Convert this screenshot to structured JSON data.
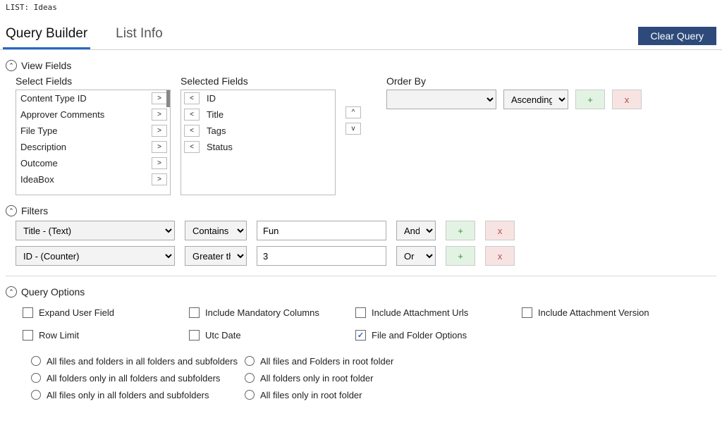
{
  "top": {
    "label": "LIST: Ideas"
  },
  "tabs": {
    "query_builder": "Query Builder",
    "list_info": "List Info"
  },
  "buttons": {
    "clear_query": "Clear Query"
  },
  "view_fields": {
    "title": "View Fields",
    "select_header": "Select Fields",
    "selected_header": "Selected Fields",
    "available": [
      "Content Type ID",
      "Approver Comments",
      "File Type",
      "Description",
      "Outcome",
      "IdeaBox"
    ],
    "selected": [
      "ID",
      "Title",
      "Tags",
      "Status"
    ],
    "glyphs": {
      "right": ">",
      "left": "<",
      "up": "^",
      "down": "v"
    }
  },
  "order_by": {
    "title": "Order By",
    "field": "",
    "direction": "Ascending",
    "plus": "+",
    "x": "x"
  },
  "filters": {
    "title": "Filters",
    "rows": [
      {
        "field": "Title - (Text)",
        "op": "Contains",
        "value": "Fun",
        "conj": "And"
      },
      {
        "field": "ID - (Counter)",
        "op": "Greater tha",
        "value": "3",
        "conj": "Or"
      }
    ],
    "plus": "+",
    "x": "x"
  },
  "options": {
    "title": "Query Options",
    "items": {
      "expand_user": "Expand User Field",
      "include_mandatory": "Include Mandatory Columns",
      "include_attach_urls": "Include Attachment Urls",
      "include_attach_version": "Include Attachment Version",
      "row_limit": "Row Limit",
      "utc_date": "Utc Date",
      "file_folder": "File and Folder Options"
    },
    "ff_left": [
      "All files and folders in all folders and subfolders",
      "All folders only in all folders and subfolders",
      "All files only in all folders and subfolders"
    ],
    "ff_right": [
      "All files and Folders in root folder",
      "All folders only in root folder",
      "All files only in root folder"
    ]
  }
}
